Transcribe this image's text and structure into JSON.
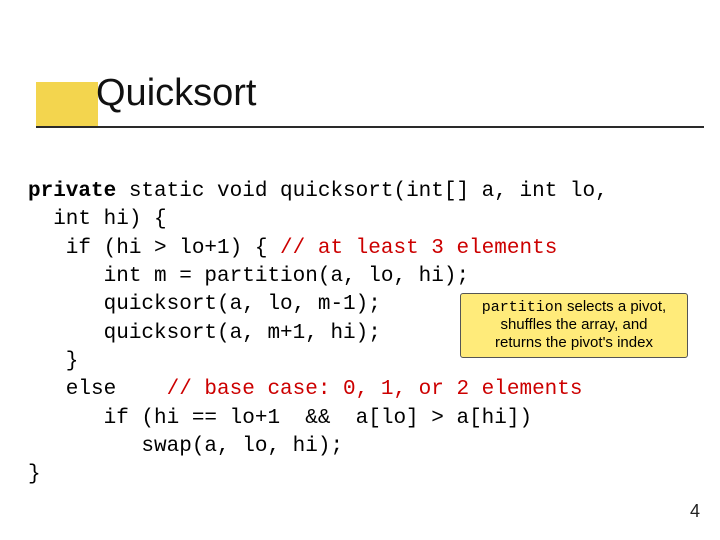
{
  "title": "Quicksort",
  "code": {
    "l1a": "private",
    "l1b": " static void quicksort(int[] a, int lo,",
    "l1c": "  int hi) {",
    "l2a": "   if (hi > lo+1) { ",
    "l2b": "// at least 3 elements",
    "l3": "      int m = partition(a, lo, hi);",
    "l4": "      quicksort(a, lo, m-1);",
    "l5": "      quicksort(a, m+1, hi);",
    "l6": "   }",
    "l7a": "   else    ",
    "l7b": "// base case: 0, 1, or 2 elements",
    "l8": "      if (hi == lo+1  &&  a[lo] > a[hi])",
    "l9": "         swap(a, lo, hi);",
    "l10": "}"
  },
  "callout": {
    "word_mono": "partition",
    "rest1": " selects a pivot,",
    "line2": "shuffles the array, and",
    "line3": "returns the pivot's index"
  },
  "slide_number": "4"
}
